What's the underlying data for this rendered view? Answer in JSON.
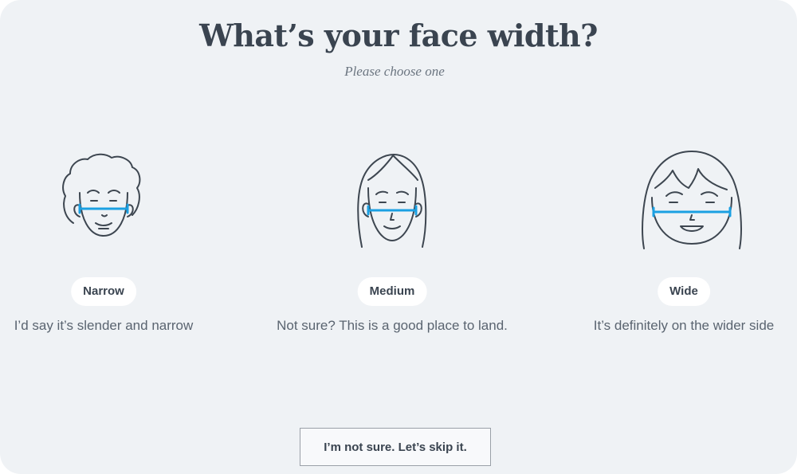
{
  "header": {
    "title": "What’s your face width?",
    "subtitle": "Please choose one"
  },
  "options": [
    {
      "label": "Narrow",
      "description": "I’d say it’s slender and narrow",
      "icon": "narrow-face-icon"
    },
    {
      "label": "Medium",
      "description": "Not sure? This is a good place to land.",
      "icon": "medium-face-icon"
    },
    {
      "label": "Wide",
      "description": "It’s definitely on the wider side",
      "icon": "wide-face-icon"
    }
  ],
  "skip": {
    "label": "I’m not sure. Let’s skip it."
  },
  "colors": {
    "background": "#eff2f5",
    "text": "#3a4450",
    "measure_line": "#1ba0e2",
    "pill": "#ffffff"
  }
}
